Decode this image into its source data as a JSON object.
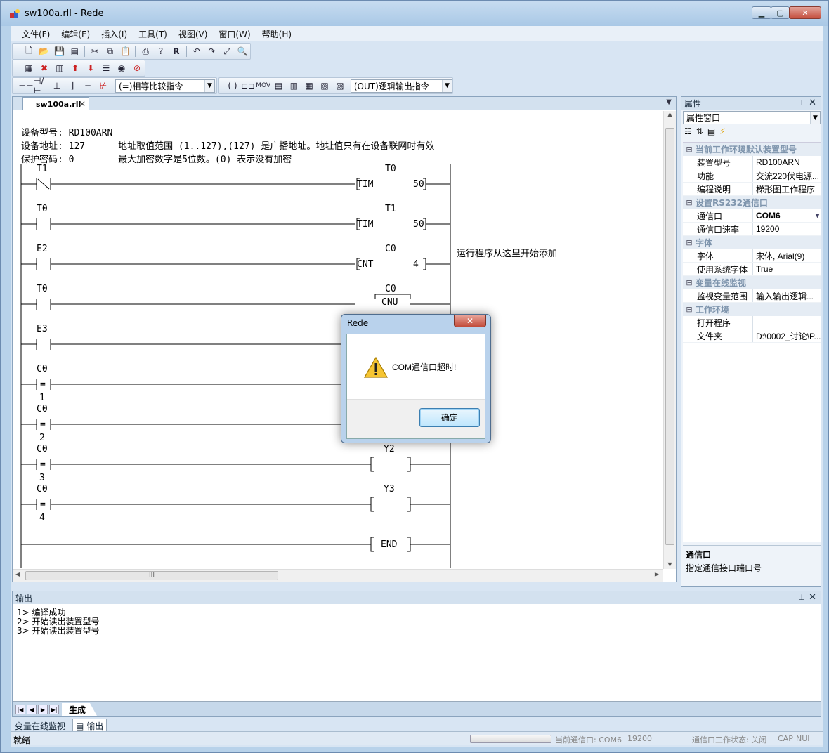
{
  "window": {
    "title": "sw100a.rll - Rede",
    "min": "▁",
    "max": "▢",
    "close": "✕"
  },
  "menu": [
    "文件(F)",
    "编辑(E)",
    "插入(I)",
    "工具(T)",
    "视图(V)",
    "窗口(W)",
    "帮助(H)"
  ],
  "toolbar3": {
    "combo1": "(=)相等比较指令",
    "combo2": "(OUT)逻辑输出指令",
    "mov": "MOV"
  },
  "doc": {
    "tab": "sw100a.rll",
    "close": "✕",
    "dropdown": "▼"
  },
  "ladder": {
    "info": [
      "设备型号: RD100ARN",
      "设备地址: 127      地址取值范围 (1..127),(127) 是广播地址。地址值只有在设备联网时有效",
      "保护密码: 0        最大加密数字是5位数。(0) 表示没有加密"
    ],
    "note": "运行程序从这里开始添加",
    "rungs": [
      {
        "contact": "T1",
        "nc": true,
        "coil": "T0",
        "box": "TIM",
        "val": "50"
      },
      {
        "contact": "T0",
        "coil": "T1",
        "box": "TIM",
        "val": "50"
      },
      {
        "contact": "E2",
        "coil": "C0",
        "box": "CNT",
        "val": "4"
      },
      {
        "contact": "T0",
        "coil": "C0",
        "box": "CNU",
        "val": ""
      },
      {
        "contact": "E3",
        "coil": "",
        "box": "",
        "val": ""
      },
      {
        "contact": "C0",
        "cmp": "=",
        "sub": "1"
      },
      {
        "contact": "C0",
        "cmp": "=",
        "sub": "2"
      },
      {
        "contact": "C0",
        "cmp": "=",
        "sub": "3",
        "coil": "Y2"
      },
      {
        "contact": "C0",
        "cmp": "=",
        "sub": "4",
        "coil": "Y3"
      }
    ],
    "end": "END"
  },
  "hscroll": "III",
  "props": {
    "title": "属性",
    "pin": "⊥",
    "close": "✕",
    "combo": "属性窗口",
    "cats": [
      {
        "name": "当前工作环境默认装置型号",
        "rows": [
          [
            "装置型号",
            "RD100ARN"
          ],
          [
            "功能",
            "交流220伏电源..."
          ],
          [
            "编程说明",
            "梯形图工作程序"
          ]
        ]
      },
      {
        "name": "设置RS232通信口",
        "rows": [
          [
            "通信口",
            "COM6"
          ],
          [
            "通信口速率",
            "19200"
          ]
        ]
      },
      {
        "name": "字体",
        "rows": [
          [
            "字体",
            "宋体, Arial(9)"
          ],
          [
            "使用系统字体",
            "True"
          ]
        ]
      },
      {
        "name": "变量在线监视",
        "rows": [
          [
            "监视变量范围",
            "输入输出逻辑..."
          ]
        ]
      },
      {
        "name": "工作环境",
        "rows": [
          [
            "打开程序",
            ""
          ],
          [
            "文件夹",
            "D:\\0002_讨论\\P..."
          ]
        ]
      }
    ],
    "desc_title": "通信口",
    "desc_text": "指定通信接口端口号"
  },
  "output": {
    "title": "输出",
    "lines": [
      "1> 编译成功",
      "2> 开始读出装置型号",
      "3> 开始读出装置型号"
    ],
    "tab": "生成"
  },
  "bottom_tabs": [
    "变量在线监视",
    "输出"
  ],
  "status": {
    "left": "就绪",
    "port": "当前通信口: COM6",
    "rate": "19200",
    "state": "通信口工作状态: 关闭",
    "cap": "CAP",
    "num": "NUI"
  },
  "modal": {
    "title": "Rede",
    "message": "COM通信口超时!",
    "ok": "确定",
    "close": "✕"
  }
}
